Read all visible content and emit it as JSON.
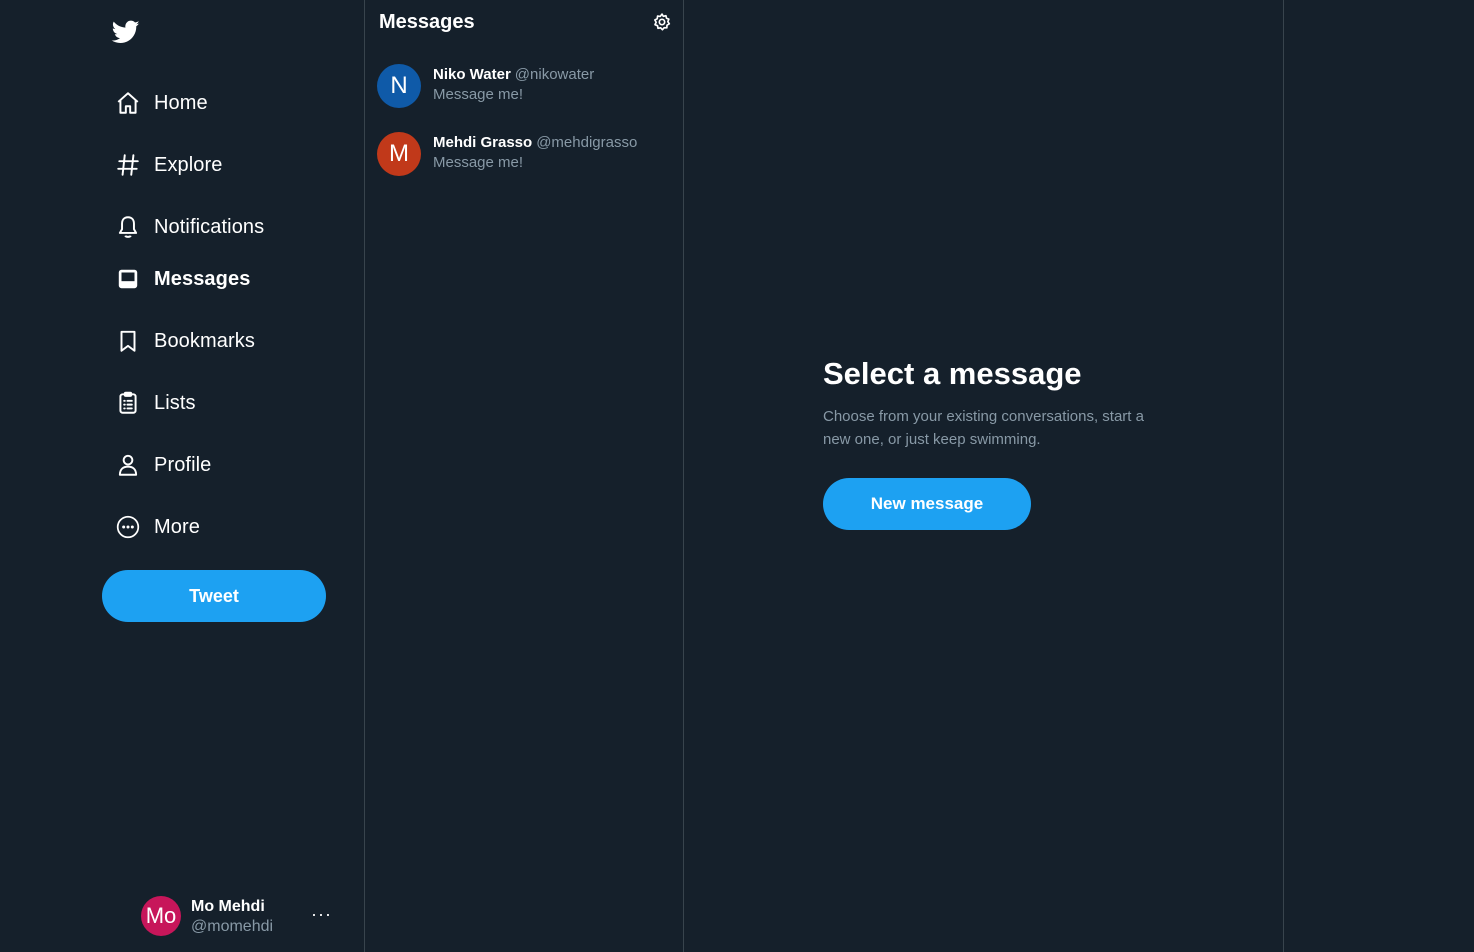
{
  "colors": {
    "background": "#15202b",
    "accent": "#1da1f2",
    "border": "#38444d",
    "secondary_text": "#8899a6"
  },
  "sidebar": {
    "logo_icon": "twitter-bird-icon",
    "nav": [
      {
        "label": "Home",
        "icon": "home-icon"
      },
      {
        "label": "Explore",
        "icon": "hashtag-icon"
      },
      {
        "label": "Notifications",
        "icon": "bell-icon"
      },
      {
        "label": "Messages",
        "icon": "inbox-icon",
        "active": true
      },
      {
        "label": "Bookmarks",
        "icon": "bookmark-icon"
      },
      {
        "label": "Lists",
        "icon": "list-icon"
      },
      {
        "label": "Profile",
        "icon": "person-icon"
      },
      {
        "label": "More",
        "icon": "more-circle-icon"
      }
    ],
    "tweet_label": "Tweet",
    "account": {
      "avatar_text": "Mo",
      "avatar_color": "#c7165a",
      "name": "Mo Mehdi",
      "handle": "@momehdi",
      "more": "···"
    }
  },
  "messages": {
    "title": "Messages",
    "conversations": [
      {
        "initial": "N",
        "avatar_color": "#0f5aa8",
        "name": "Niko Water",
        "handle": "@nikowater",
        "snippet": "Message me!"
      },
      {
        "initial": "M",
        "avatar_color": "#c1391a",
        "name": "Mehdi Grasso",
        "handle": "@mehdigrasso",
        "snippet": "Message me!"
      }
    ]
  },
  "detail": {
    "title": "Select a message",
    "subtitle": "Choose from your existing conversations, start a new one, or just keep swimming.",
    "button_label": "New message"
  }
}
